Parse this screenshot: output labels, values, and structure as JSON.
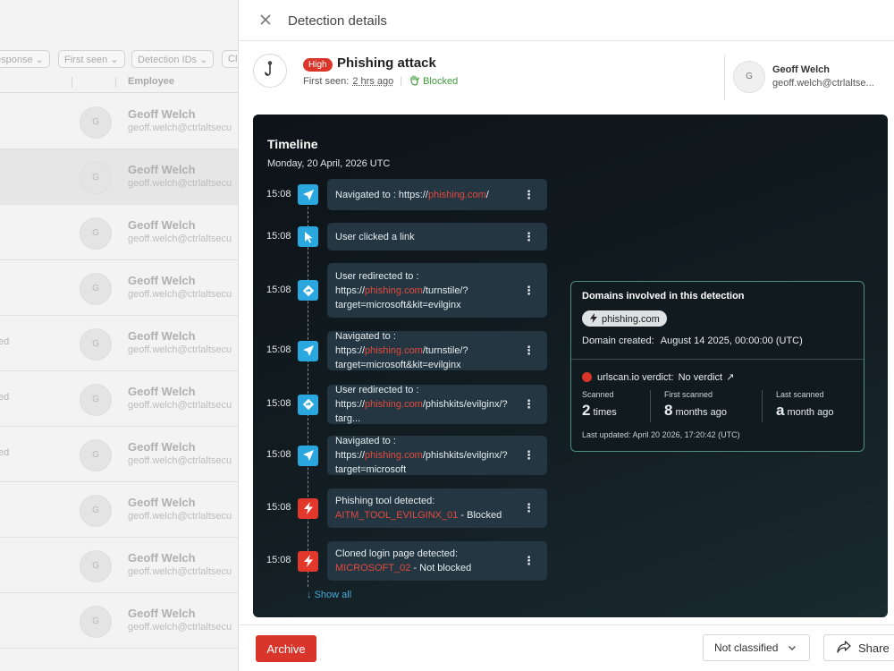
{
  "background": {
    "filters": [
      "esponse",
      "First seen",
      "Detection IDs",
      "Cl"
    ],
    "employee_header": "Employee",
    "rows": [
      {
        "avatar": "G",
        "name": "Geoff Welch",
        "email": "geoff.welch@ctrlaltsecu",
        "left": ""
      },
      {
        "avatar": "G",
        "name": "Geoff Welch",
        "email": "geoff.welch@ctrlaltsecu",
        "left": ""
      },
      {
        "avatar": "G",
        "name": "Geoff Welch",
        "email": "geoff.welch@ctrlaltsecu",
        "left": ""
      },
      {
        "avatar": "G",
        "name": "Geoff Welch",
        "email": "geoff.welch@ctrlaltsecu",
        "left": ""
      },
      {
        "avatar": "G",
        "name": "Geoff Welch",
        "email": "geoff.welch@ctrlaltsecu",
        "left": "ed"
      },
      {
        "avatar": "G",
        "name": "Geoff Welch",
        "email": "geoff.welch@ctrlaltsecu",
        "left": "ed"
      },
      {
        "avatar": "G",
        "name": "Geoff Welch",
        "email": "geoff.welch@ctrlaltsecu",
        "left": "ed"
      },
      {
        "avatar": "G",
        "name": "Geoff Welch",
        "email": "geoff.welch@ctrlaltsecu",
        "left": ""
      },
      {
        "avatar": "G",
        "name": "Geoff Welch",
        "email": "geoff.welch@ctrlaltsecu",
        "left": ""
      },
      {
        "avatar": "G",
        "name": "Geoff Welch",
        "email": "geoff.welch@ctrlaltsecu",
        "left": ""
      }
    ]
  },
  "panel": {
    "title": "Detection details",
    "severity": "High",
    "detection_title": "Phishing attack",
    "first_seen_label": "First seen:",
    "first_seen_value": "2 hrs ago",
    "status": "Blocked",
    "user": {
      "avatar": "G",
      "name": "Geoff Welch",
      "email": "geoff.welch@ctrlaltse..."
    }
  },
  "timeline": {
    "title": "Timeline",
    "date": "Monday, 20 April, 2026 UTC",
    "events": [
      {
        "time": "15:08",
        "icon": "navigate-icon",
        "color": "blue",
        "parts": [
          [
            "Navigated to :  https://",
            ""
          ],
          [
            "phishing.com",
            "red"
          ],
          [
            "/",
            ""
          ]
        ]
      },
      {
        "time": "15:08",
        "icon": "cursor-icon",
        "color": "blue",
        "parts": [
          [
            "User clicked a link",
            ""
          ]
        ]
      },
      {
        "time": "15:08",
        "icon": "redirect-icon",
        "color": "blue",
        "parts": [
          [
            "User redirected to :  https://",
            ""
          ],
          [
            "phishing.com",
            "red"
          ],
          [
            "/turnstile/?target=microsoft&kit=evilginx",
            ""
          ]
        ]
      },
      {
        "time": "15:08",
        "icon": "navigate-icon",
        "color": "blue",
        "parts": [
          [
            "Navigated to :  https://",
            ""
          ],
          [
            "phishing.com",
            "red"
          ],
          [
            "/turnstile/?target=microsoft&kit=evilginx",
            ""
          ]
        ]
      },
      {
        "time": "15:08",
        "icon": "redirect-icon",
        "color": "blue",
        "parts": [
          [
            "User redirected to :  https://",
            ""
          ],
          [
            "phishing.com",
            "red"
          ],
          [
            "/phishkits/evilginx/?targ...",
            ""
          ]
        ]
      },
      {
        "time": "15:08",
        "icon": "navigate-icon",
        "color": "blue",
        "parts": [
          [
            "Navigated to :  https://",
            ""
          ],
          [
            "phishing.com",
            "red"
          ],
          [
            "/phishkits/evilginx/?target=microsoft",
            ""
          ]
        ]
      },
      {
        "time": "15:08",
        "icon": "bolt-icon",
        "color": "red",
        "parts": [
          [
            "Phishing tool detected:",
            "br"
          ],
          [
            "AITM_TOOL_EVILGINX_01",
            "red"
          ],
          [
            " - Blocked",
            ""
          ]
        ]
      },
      {
        "time": "15:08",
        "icon": "bolt-icon",
        "color": "red",
        "parts": [
          [
            "Cloned login page detected:",
            "br"
          ],
          [
            "MICROSOFT_02",
            "red"
          ],
          [
            " - Not blocked",
            ""
          ]
        ]
      }
    ],
    "show_all": "Show all"
  },
  "domains": {
    "title": "Domains involved in this detection",
    "chip": "phishing.com",
    "created_label": "Domain created:",
    "created_value": "August 14 2025, 00:00:00 (UTC)",
    "verdict_label": "urlscan.io verdict:",
    "verdict_value": "No verdict",
    "stats": [
      {
        "label": "Scanned",
        "big": "2",
        "small": "times"
      },
      {
        "label": "First scanned",
        "big": "8",
        "small": "months ago"
      },
      {
        "label": "Last scanned",
        "big": "a",
        "small": "month ago"
      }
    ],
    "last_updated": "Last updated: April 20 2026, 17:20:42 (UTC)"
  },
  "footer": {
    "archive": "Archive",
    "classification": "Not classified",
    "share": "Share"
  },
  "colors": {
    "accent_red": "#d9352a",
    "accent_blue": "#2ba7df",
    "success_green": "#3f9a3a"
  }
}
